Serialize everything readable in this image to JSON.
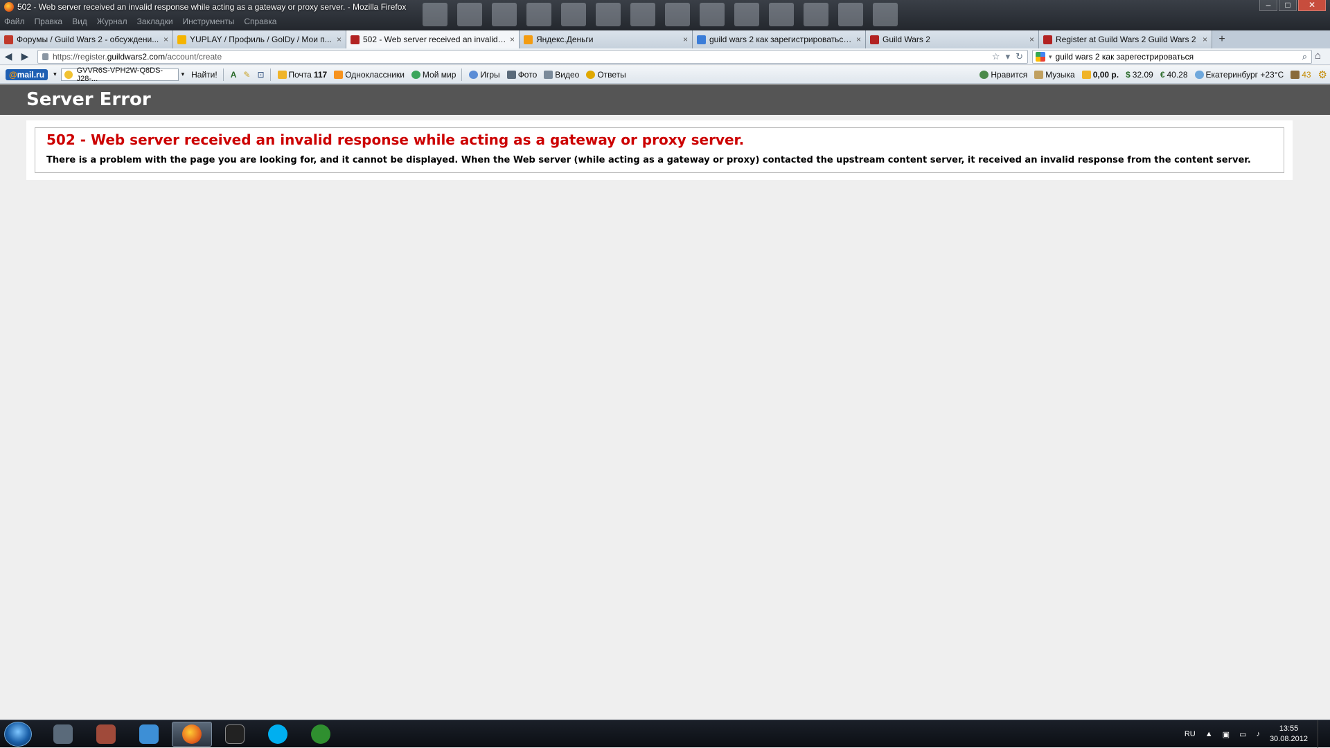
{
  "window": {
    "title": "502 - Web server received an invalid response while acting as a gateway or proxy server. - Mozilla Firefox",
    "menu": [
      "Файл",
      "Правка",
      "Вид",
      "Журнал",
      "Закладки",
      "Инструменты",
      "Справка"
    ],
    "minimize": "–",
    "maximize": "□",
    "close": "✕"
  },
  "tabs": [
    {
      "label": "Форумы / Guild Wars 2 - обсуждени...",
      "fav_color": "#c0392b"
    },
    {
      "label": "YUPLAY / Профиль / GolDy / Мои п...",
      "fav_color": "#f5b400"
    },
    {
      "label": "502 - Web server received an invalid r...",
      "fav_color": "#b22222",
      "active": true
    },
    {
      "label": "Яндекс.Деньги",
      "fav_color": "#f39c12"
    },
    {
      "label": "guild wars 2 как зарегистрироваться...",
      "fav_color": "#3b7dd8"
    },
    {
      "label": "Guild Wars 2",
      "fav_color": "#b22222"
    },
    {
      "label": "Register at Guild Wars 2 Guild Wars 2",
      "fav_color": "#b22222"
    }
  ],
  "tab_close": "×",
  "new_tab": "+",
  "nav": {
    "back": "◀",
    "forward": "▶",
    "url_prefix": "https://register.",
    "url_domain": "guildwars2.com",
    "url_path": "/account/create",
    "star": "☆",
    "reload": "↻",
    "search_value": "guild wars 2 как зарегестрироваться",
    "search_icon": "⌕",
    "home_icon": "⌂"
  },
  "mailbar": {
    "logo_at": "@",
    "logo_text": "mail.ru",
    "search_value": "GVVR6S-VPH2W-Q8DS-J28-...",
    "find": "Найти!",
    "mail_label": "Почта",
    "mail_count": "117",
    "ok": "Одноклассники",
    "myworld": "Мой мир",
    "games": "Игры",
    "photo": "Фото",
    "video": "Видео",
    "answers": "Ответы",
    "like": "Нравится",
    "music": "Музыка",
    "money": "0,00 р.",
    "usd": "32.09",
    "eur": "40.28",
    "weather": "Екатеринбург +23°C",
    "notif": "43"
  },
  "page": {
    "header": "Server Error",
    "error_title": "502 - Web server received an invalid response while acting as a gateway or proxy server.",
    "error_text": "There is a problem with the page you are looking for, and it cannot be displayed. When the Web server (while acting as a gateway or proxy) contacted the upstream content server, it received an invalid response from the content server."
  },
  "taskbar": {
    "lang": "RU",
    "time": "13:55",
    "date": "30.08.2012",
    "apps": [
      {
        "name": "media-app",
        "color": "#5a6a7a"
      },
      {
        "name": "archive-app",
        "color": "#a04a3a"
      },
      {
        "name": "music-app",
        "color": "#3d8fd6"
      },
      {
        "name": "firefox-app",
        "color": "#e5671f",
        "active": true
      },
      {
        "name": "pw-app",
        "color": "#222222"
      },
      {
        "name": "skype-app",
        "color": "#00aff0"
      },
      {
        "name": "utorrent-app",
        "color": "#2f8f2f"
      }
    ]
  }
}
